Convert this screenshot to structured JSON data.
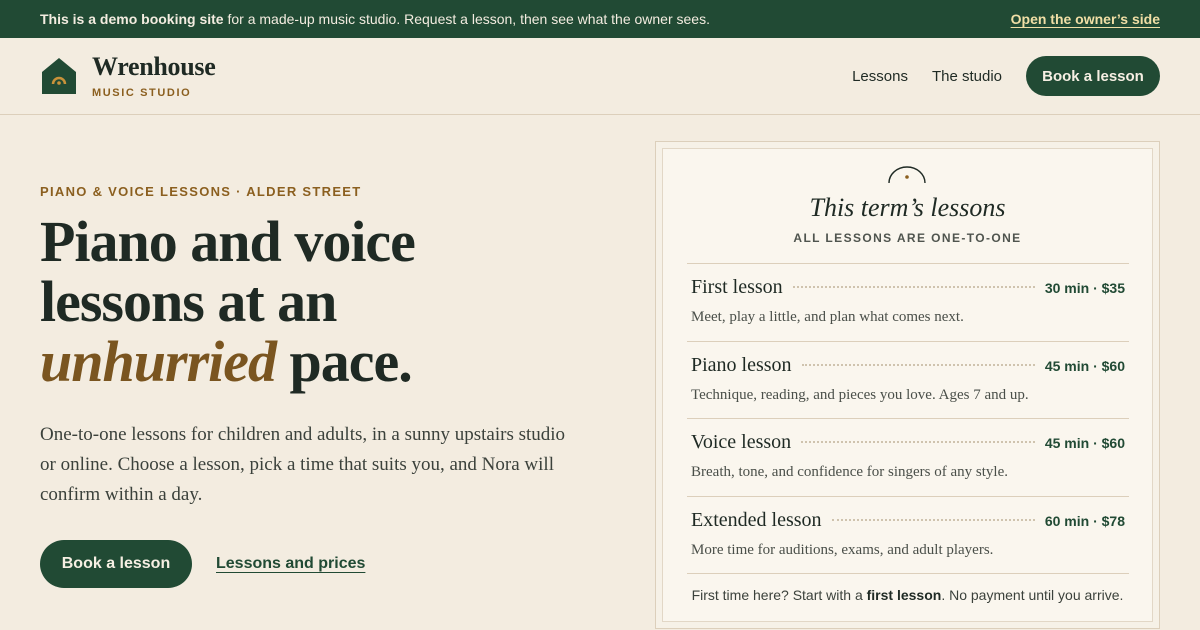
{
  "banner": {
    "bold_text": "This is a demo booking site",
    "text": " for a made-up music studio. Request a lesson, then see what the owner sees.",
    "owner_link": "Open the owner’s side"
  },
  "brand": {
    "name": "Wrenhouse",
    "sub": "MUSIC STUDIO",
    "logo_icon": "house-icon"
  },
  "nav": {
    "lessons": "Lessons",
    "studio": "The studio",
    "book": "Book a lesson"
  },
  "hero": {
    "eyebrow": "PIANO & VOICE LESSONS · ALDER STREET",
    "headline_1": "Piano and voice",
    "headline_2": "lessons at an",
    "headline_em": "unhurried",
    "headline_3": " pace.",
    "lede": "One-to-one lessons for children and adults, in a sunny upstairs studio or online. Choose a lesson, pick a time that suits you, and Nora will confirm within a day.",
    "cta_primary": "Book a lesson",
    "cta_secondary": "Lessons and prices"
  },
  "card": {
    "icon": "arch-icon",
    "title": "This term’s lessons",
    "subtitle": "ALL LESSONS ARE ONE-TO-ONE",
    "lessons": [
      {
        "name": "First lesson",
        "price": "30 min · $35",
        "desc": "Meet, play a little, and plan what comes next."
      },
      {
        "name": "Piano lesson",
        "price": "45 min · $60",
        "desc": "Technique, reading, and pieces you love. Ages 7 and up."
      },
      {
        "name": "Voice lesson",
        "price": "45 min · $60",
        "desc": "Breath, tone, and confidence for singers of any style."
      },
      {
        "name": "Extended lesson",
        "price": "60 min · $78",
        "desc": "More time for auditions, exams, and adult players."
      }
    ],
    "footer_pre": "First time here? Start with a ",
    "footer_bold": "first lesson",
    "footer_post": ". No payment until you arrive."
  },
  "colors": {
    "brand_green": "#214a34",
    "accent_brown": "#8b5f1f",
    "background": "#f3ece0"
  }
}
